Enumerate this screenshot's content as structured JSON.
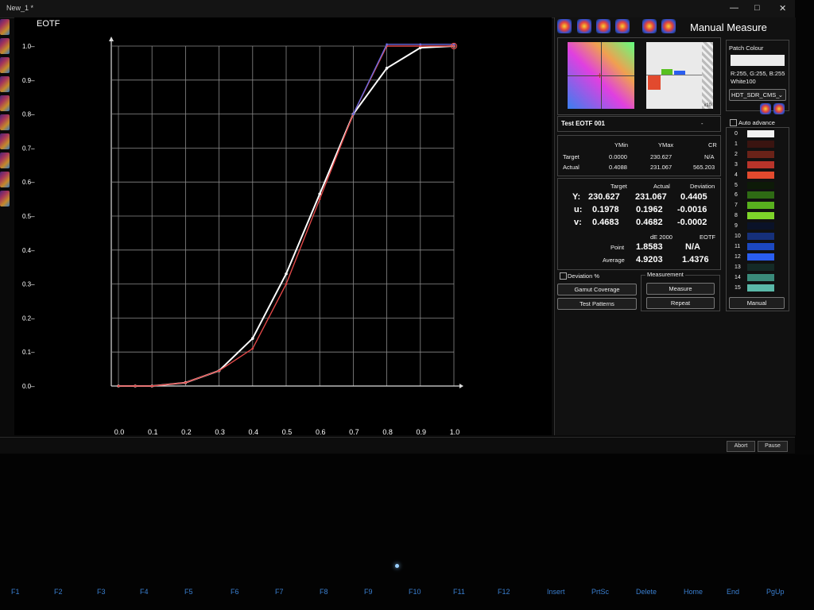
{
  "window": {
    "title": "New_1 *",
    "minimize": "—",
    "maximize": "□",
    "close": "✕"
  },
  "chart_data": {
    "type": "line",
    "title": "EOTF",
    "xlabel": "",
    "ylabel": "",
    "xlim": [
      0,
      1.0
    ],
    "ylim": [
      0,
      1.0
    ],
    "x_ticks": [
      "0.0",
      "0.1",
      "0.2",
      "0.3",
      "0.4",
      "0.5",
      "0.6",
      "0.7",
      "0.8",
      "0.9",
      "1.0"
    ],
    "y_ticks": [
      "0.0",
      "0.1",
      "0.2",
      "0.3",
      "0.4",
      "0.5",
      "0.6",
      "0.7",
      "0.8",
      "0.9",
      "1.0"
    ],
    "grid": true,
    "series": [
      {
        "color": "#ffffff",
        "x": [
          0,
          0.05,
          0.1,
          0.2,
          0.3,
          0.4,
          0.5,
          0.6,
          0.7,
          0.8,
          0.9,
          1.0
        ],
        "y": [
          0,
          0,
          0,
          0.01,
          0.045,
          0.14,
          0.33,
          0.565,
          0.8,
          0.935,
          0.995,
          1.0
        ]
      },
      {
        "color": "#e04848",
        "x": [
          0,
          0.05,
          0.1,
          0.2,
          0.3,
          0.4,
          0.5,
          0.6,
          0.7,
          0.8,
          0.9,
          1.0
        ],
        "y": [
          0,
          0,
          0,
          0.01,
          0.045,
          0.11,
          0.3,
          0.55,
          0.8,
          1.0,
          1.0,
          1.0
        ]
      },
      {
        "color": "#6a6ae0",
        "x": [
          0.7,
          0.8,
          0.9,
          1.0
        ],
        "y": [
          0.8,
          1.005,
          1.005,
          1.005
        ]
      }
    ]
  },
  "panel": {
    "title": "Manual Measure",
    "patch_colour": {
      "label": "Patch Colour",
      "rgb": "R:255, G:255, B:255",
      "name": "White100",
      "dropdown": "HDT_SDR_CMS_"
    },
    "chart_zoom": "x10",
    "test_name": "Test EOTF 001",
    "test_suffix": "-",
    "auto_advance": "Auto advance",
    "summary": {
      "headers": [
        "YMin",
        "YMax",
        "CR"
      ],
      "rows": [
        {
          "label": "Target",
          "values": [
            "0.0000",
            "230.627",
            "N/A"
          ]
        },
        {
          "label": "Actual",
          "values": [
            "0.4088",
            "231.067",
            "565.203"
          ]
        }
      ]
    },
    "detail": {
      "headers": [
        "Target",
        "Actual",
        "Deviation"
      ],
      "rows": [
        {
          "label": "Y:",
          "values": [
            "230.627",
            "231.067",
            "0.4405"
          ]
        },
        {
          "label": "u:",
          "values": [
            "0.1978",
            "0.1962",
            "-0.0016"
          ]
        },
        {
          "label": "v:",
          "values": [
            "0.4683",
            "0.4682",
            "-0.0002"
          ]
        }
      ],
      "de_headers": [
        "dE 2000",
        "EOTF"
      ],
      "point_label": "Point",
      "point_values": [
        "1.8583",
        "N/A"
      ],
      "average_label": "Average",
      "average_values": [
        "4.9203",
        "1.4376"
      ]
    },
    "deviation_pct": "Deviation %",
    "gamut_coverage": "Gamut Coverage",
    "test_patterns": "Test Patterns",
    "measurement_group": "Measurement",
    "measure": "Measure",
    "repeat": "Repeat",
    "manual": "Manual",
    "patches": [
      {
        "n": "0",
        "c": "#f2f2f2"
      },
      {
        "n": "1",
        "c": "#3a1410"
      },
      {
        "n": "2",
        "c": "#6a2218"
      },
      {
        "n": "3",
        "c": "#b8342a"
      },
      {
        "n": "4",
        "c": "#e24a2e"
      },
      {
        "n": "5",
        "c": "#0d1a08"
      },
      {
        "n": "6",
        "c": "#2e6a14"
      },
      {
        "n": "7",
        "c": "#58b01e"
      },
      {
        "n": "8",
        "c": "#7ed42a"
      },
      {
        "n": "9",
        "c": "#0a1228"
      },
      {
        "n": "10",
        "c": "#16307a"
      },
      {
        "n": "11",
        "c": "#1c48c0"
      },
      {
        "n": "12",
        "c": "#2a5ef0"
      },
      {
        "n": "13",
        "c": "#142a26"
      },
      {
        "n": "14",
        "c": "#3a8a7a"
      },
      {
        "n": "15",
        "c": "#5ab8a8"
      }
    ]
  },
  "status": {
    "abort": "Abort",
    "pause": "Pause"
  },
  "keyboard": [
    "F1",
    "F2",
    "F3",
    "F4",
    "F5",
    "F6",
    "F7",
    "F8",
    "F9",
    "F10",
    "F11",
    "F12",
    "Insert",
    "PrtSc",
    "Delete",
    "Home",
    "End",
    "PgUp"
  ]
}
